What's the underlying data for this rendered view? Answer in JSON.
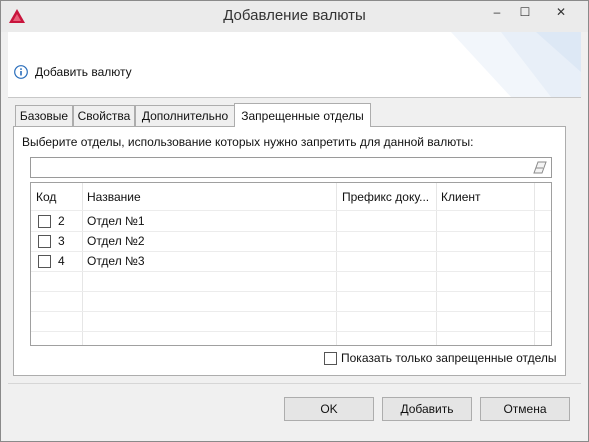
{
  "window": {
    "title": "Добавление валюты",
    "minimize_glyph": "‒",
    "maximize_glyph": "☐",
    "close_glyph": "✕"
  },
  "header": {
    "icon": "info-icon",
    "text": "Добавить валюту"
  },
  "tabs": [
    {
      "label": "Базовые",
      "active": false
    },
    {
      "label": "Свойства",
      "active": false
    },
    {
      "label": "Дополнительно",
      "active": false
    },
    {
      "label": "Запрещенные отделы",
      "active": true
    }
  ],
  "panel": {
    "hint": "Выберите отделы, использование которых нужно запретить для данной валюты:",
    "search": {
      "value": "",
      "placeholder": "",
      "icon": "eraser-icon"
    },
    "columns": [
      "Код",
      "Название",
      "Префикс доку...",
      "Клиент"
    ],
    "rows": [
      {
        "checked": false,
        "code": "2",
        "name": "Отдел №1",
        "prefix": "",
        "client": ""
      },
      {
        "checked": false,
        "code": "3",
        "name": "Отдел №2",
        "prefix": "",
        "client": ""
      },
      {
        "checked": false,
        "code": "4",
        "name": "Отдел №3",
        "prefix": "",
        "client": ""
      }
    ],
    "show_only_label": "Показать только запрещенные отделы",
    "show_only_checked": false
  },
  "buttons": {
    "ok": "OK",
    "add": "Добавить",
    "cancel": "Отмена"
  },
  "colors": {
    "app_icon": "#c8143c",
    "info_icon": "#2a6ebb"
  }
}
